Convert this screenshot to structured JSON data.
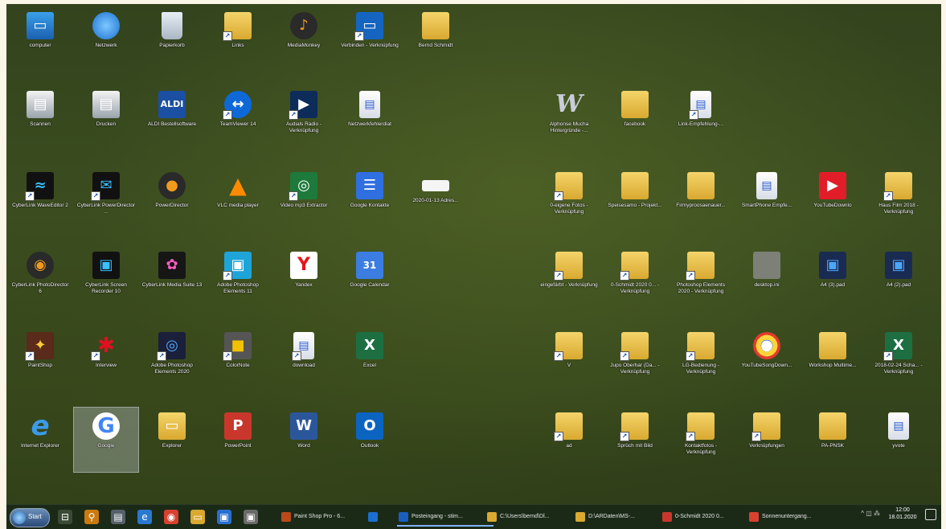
{
  "desktop": {
    "left_icons": [
      {
        "label": "computer",
        "glyph": "▭",
        "style": "g-pc",
        "shortcut": false
      },
      {
        "label": "Netzwerk",
        "glyph": "",
        "style": "g-net",
        "shortcut": false
      },
      {
        "label": "Papierkorb",
        "glyph": "",
        "style": "g-bin",
        "shortcut": false
      },
      {
        "label": "Links",
        "glyph": "",
        "style": "g-folder",
        "shortcut": true
      },
      {
        "label": "MediaMonkey",
        "glyph": "♪",
        "style": "g-orange",
        "shortcut": false
      },
      {
        "label": "Verbinden - Verknüpfung",
        "glyph": "▭",
        "style": "g-blue",
        "shortcut": true
      },
      {
        "label": "Bernd Schmidt",
        "glyph": "",
        "style": "g-folder",
        "shortcut": false
      },
      {
        "label": "Scannen",
        "glyph": "▤",
        "style": "g-printer",
        "shortcut": false
      },
      {
        "label": "Drucken",
        "glyph": "▤",
        "style": "g-printer",
        "shortcut": false
      },
      {
        "label": "ALDI Bestellsoftware",
        "glyph": "ALDI",
        "style": "g-aldi",
        "shortcut": false
      },
      {
        "label": "TeamViewer 14",
        "glyph": "↔",
        "style": "g-tv",
        "shortcut": true
      },
      {
        "label": "Audials Radio - Verknüpfung",
        "glyph": "▶",
        "style": "g-darkblue",
        "shortcut": true
      },
      {
        "label": "Netzwerkfehlerdiat",
        "glyph": "▤",
        "style": "g-doc",
        "shortcut": false
      },
      {
        "label": "CyberLink WaveEditor 2",
        "glyph": "≈",
        "style": "g-film",
        "shortcut": true
      },
      {
        "label": "CyberLink PowerDirector ...",
        "glyph": "✉",
        "style": "g-film",
        "shortcut": true
      },
      {
        "label": "PowerDirector",
        "glyph": "●",
        "style": "g-orange",
        "shortcut": false
      },
      {
        "label": "VLC media player",
        "glyph": "▲",
        "style": "g-vlc",
        "shortcut": false
      },
      {
        "label": "Video mp3 Extractor",
        "glyph": "◎",
        "style": "g-green",
        "shortcut": true
      },
      {
        "label": "Google Kontakte",
        "glyph": "☰",
        "style": "g-contacts",
        "shortcut": false
      },
      {
        "label": "2020-01-13 Adres...",
        "glyph": "",
        "style": "g-env",
        "shortcut": false
      },
      {
        "label": "CyberLink PhotoDirector 6",
        "glyph": "◉",
        "style": "g-orange",
        "shortcut": false
      },
      {
        "label": "CyberLink Screen Recorder 10",
        "glyph": "▣",
        "style": "g-film",
        "shortcut": false
      },
      {
        "label": "CyberLink Media Suite 13",
        "glyph": "✿",
        "style": "g-flower",
        "shortcut": false
      },
      {
        "label": "Adobe Photoshop Elements 11",
        "glyph": "▣",
        "style": "g-psd",
        "shortcut": true
      },
      {
        "label": "Yandex",
        "glyph": "Y",
        "style": "g-yandex",
        "shortcut": false
      },
      {
        "label": "Google Calendar",
        "glyph": "31",
        "style": "g-cal",
        "shortcut": false
      },
      {
        "label": "PaintShop",
        "glyph": "✦",
        "style": "g-ps",
        "shortcut": true
      },
      {
        "label": "Interview",
        "glyph": "✱",
        "style": "g-red",
        "shortcut": true
      },
      {
        "label": "Adobe Photoshop Elements 2020",
        "glyph": "◎",
        "style": "g-pse",
        "shortcut": true
      },
      {
        "label": "ColorNote",
        "glyph": "■",
        "style": "g-gray",
        "shortcut": true
      },
      {
        "label": "download",
        "glyph": "▤",
        "style": "g-doc",
        "shortcut": true
      },
      {
        "label": "Excel",
        "glyph": "X",
        "style": "g-excel",
        "shortcut": false
      },
      {
        "label": "Internet Explorer",
        "glyph": "e",
        "style": "g-ie",
        "shortcut": false
      },
      {
        "label": "Google",
        "glyph": "G",
        "style": "g-google",
        "shortcut": false,
        "selected": true
      },
      {
        "label": "Explorer",
        "glyph": "▭",
        "style": "g-folder",
        "shortcut": false
      },
      {
        "label": "PowerPoint",
        "glyph": "P",
        "style": "g-pptx",
        "shortcut": false
      },
      {
        "label": "Word",
        "glyph": "W",
        "style": "g-word",
        "shortcut": false
      },
      {
        "label": "Outlook",
        "glyph": "O",
        "style": "g-outlook",
        "shortcut": false
      }
    ],
    "right_icons": [
      {
        "label": "Alphonse Mucha Hintergründe -...",
        "glyph": "W",
        "style": "g-wsig",
        "shortcut": false
      },
      {
        "label": "facebook",
        "glyph": "",
        "style": "g-folder",
        "shortcut": false
      },
      {
        "label": "Link-Empfehlung-...",
        "glyph": "▤",
        "style": "g-doc",
        "shortcut": true
      },
      {
        "label": "0-eigene Fotos - Verknüpfung",
        "glyph": "",
        "style": "g-folder",
        "shortcut": true
      },
      {
        "label": "Speisesamo - Projekt...",
        "glyph": "",
        "style": "g-folder",
        "shortcut": false
      },
      {
        "label": "Firmyproosaenauer...",
        "glyph": "",
        "style": "g-folder",
        "shortcut": false
      },
      {
        "label": "SmartPhone Empfe...",
        "glyph": "▤",
        "style": "g-doc",
        "shortcut": false
      },
      {
        "label": "YouTubeDownlo",
        "glyph": "▶",
        "style": "g-youtube",
        "shortcut": false
      },
      {
        "label": "Haus Film 2018 - Verknüpfung",
        "glyph": "",
        "style": "g-folder",
        "shortcut": true
      },
      {
        "label": "eingefärbt - Verknüpfung",
        "glyph": "",
        "style": "g-folder",
        "shortcut": true
      },
      {
        "label": "0-Schmidt 2020 0... - Verknüpfung",
        "glyph": "",
        "style": "g-folder",
        "shortcut": true
      },
      {
        "label": "Photoshop Elements 2020 - Verknüpfung",
        "glyph": "",
        "style": "g-folder",
        "shortcut": true
      },
      {
        "label": "desktop.ini",
        "glyph": "",
        "style": "g-mask",
        "shortcut": false
      },
      {
        "label": "A4 (3).pad",
        "glyph": "▣",
        "style": "g-camera",
        "shortcut": false
      },
      {
        "label": "A4 (2).pad",
        "glyph": "▣",
        "style": "g-camera",
        "shortcut": false
      },
      {
        "label": "V",
        "glyph": "",
        "style": "g-folder",
        "shortcut": true
      },
      {
        "label": "Jupo Oberhar (Da... - Verknüpfung",
        "glyph": "",
        "style": "g-folder",
        "shortcut": true
      },
      {
        "label": "LG-Bedienung - Verknüpfung",
        "glyph": "",
        "style": "g-folder",
        "shortcut": true
      },
      {
        "label": "YouTubeSongDown...",
        "glyph": "●",
        "style": "g-chrome",
        "shortcut": false
      },
      {
        "label": "Workshop Multime...",
        "glyph": "",
        "style": "g-folder",
        "shortcut": false
      },
      {
        "label": "2018-02-24 Scha... - Verknüpfung",
        "glyph": "X",
        "style": "g-excel",
        "shortcut": true
      },
      {
        "label": "ad",
        "glyph": "",
        "style": "g-folder",
        "shortcut": true
      },
      {
        "label": "Sprüch mit Bild",
        "glyph": "",
        "style": "g-folder",
        "shortcut": true
      },
      {
        "label": "Kontaktfotos - Verknüpfung",
        "glyph": "",
        "style": "g-folder",
        "shortcut": true
      },
      {
        "label": "Verknüpfungen",
        "glyph": "",
        "style": "g-folder",
        "shortcut": true
      },
      {
        "label": "PA-PNSK",
        "glyph": "",
        "style": "g-folder",
        "shortcut": false
      },
      {
        "label": "yvote",
        "glyph": "▤",
        "style": "g-doc",
        "shortcut": false
      }
    ]
  },
  "taskbar": {
    "start_label": "Start",
    "pinned": [
      {
        "name": "task-view-icon",
        "glyph": "⊟",
        "color": "#3a4a34"
      },
      {
        "name": "search-icon",
        "glyph": "⚲",
        "color": "#c97a10"
      },
      {
        "name": "printer-icon",
        "glyph": "▤",
        "color": "#55606a"
      },
      {
        "name": "internet-explorer-icon",
        "glyph": "e",
        "color": "#2a78d0"
      },
      {
        "name": "chrome-icon",
        "glyph": "◉",
        "color": "#d8412f"
      },
      {
        "name": "folder-icon",
        "glyph": "▭",
        "color": "#d9a930"
      },
      {
        "name": "store-icon",
        "glyph": "▣",
        "color": "#2a6fd0"
      },
      {
        "name": "app-icon",
        "glyph": "▣",
        "color": "#6a6a6a"
      }
    ],
    "tasks": [
      {
        "label": "Paint Shop Pro - 6...",
        "color": "#b94a1a"
      },
      {
        "label": "",
        "color": "#1a6fd0"
      },
      {
        "label": "Posteingang - stim...",
        "color": "#1a5fc0"
      },
      {
        "label": "C:\\Users\\bernd\\Dl...",
        "color": "#d9a930"
      },
      {
        "label": "D:\\ARDaten\\MS-...",
        "color": "#d9a930"
      },
      {
        "label": "0-Schmidt 2020 0...",
        "color": "#c9372c"
      },
      {
        "label": "Sonnenuntergang...",
        "color": "#d8412f"
      }
    ],
    "tray_icons": "^ ◫ ⁂",
    "time": "12:00",
    "date": "18.01.2020"
  }
}
